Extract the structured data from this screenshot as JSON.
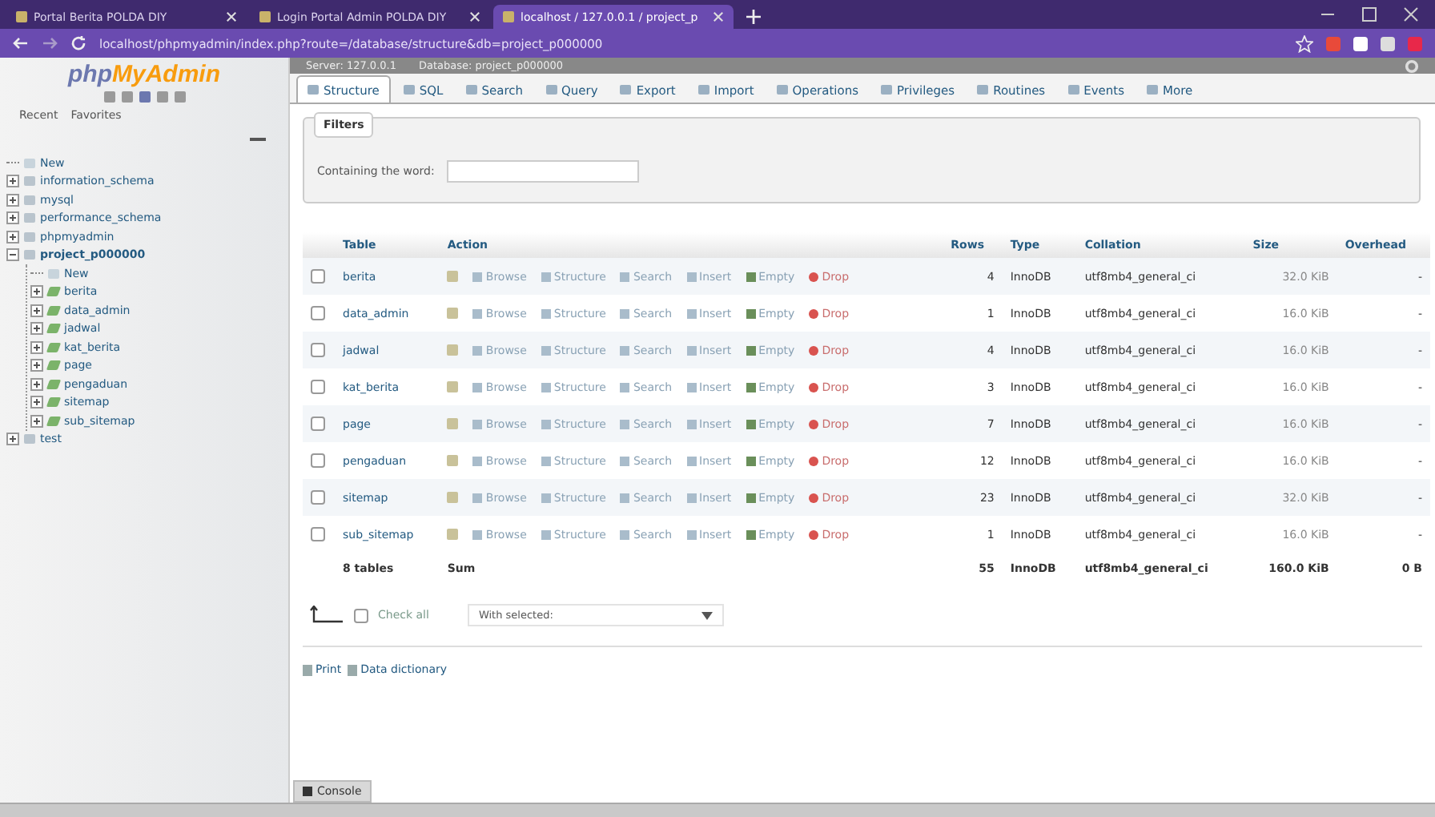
{
  "browser": {
    "tabs": [
      {
        "title": "Portal Berita POLDA DIY",
        "selected": false
      },
      {
        "title": "Login Portal Admin POLDA DIY",
        "selected": false
      },
      {
        "title": "localhost / 127.0.0.1 / project_p",
        "selected": true
      }
    ],
    "address": "localhost/phpmyadmin/index.php?route=/database/structure&db=project_p000000"
  },
  "sidebar": {
    "logo_left": "php",
    "logo_right": "MyAdmin",
    "links": [
      "Recent",
      "Favorites"
    ],
    "tree": [
      {
        "label": "New",
        "kind": "new"
      },
      {
        "label": "information_schema",
        "kind": "db",
        "expanded": false
      },
      {
        "label": "mysql",
        "kind": "db",
        "expanded": false
      },
      {
        "label": "performance_schema",
        "kind": "db",
        "expanded": false
      },
      {
        "label": "phpmyadmin",
        "kind": "db",
        "expanded": false
      },
      {
        "label": "project_p000000",
        "kind": "db",
        "expanded": true,
        "children": [
          {
            "label": "New",
            "kind": "new"
          },
          {
            "label": "berita",
            "kind": "table",
            "expanded": false
          },
          {
            "label": "data_admin",
            "kind": "table",
            "expanded": false
          },
          {
            "label": "jadwal",
            "kind": "table",
            "expanded": false
          },
          {
            "label": "kat_berita",
            "kind": "table",
            "expanded": false
          },
          {
            "label": "page",
            "kind": "table",
            "expanded": false
          },
          {
            "label": "pengaduan",
            "kind": "table",
            "expanded": false
          },
          {
            "label": "sitemap",
            "kind": "table",
            "expanded": false
          },
          {
            "label": "sub_sitemap",
            "kind": "table",
            "expanded": false
          }
        ]
      },
      {
        "label": "test",
        "kind": "db",
        "expanded": false
      }
    ]
  },
  "breadcrumb": [
    "Server: 127.0.0.1",
    "Database: project_p000000"
  ],
  "menu": [
    {
      "label": "Structure",
      "selected": true
    },
    {
      "label": "SQL",
      "selected": false
    },
    {
      "label": "Search",
      "selected": false
    },
    {
      "label": "Query",
      "selected": false
    },
    {
      "label": "Export",
      "selected": false
    },
    {
      "label": "Import",
      "selected": false
    },
    {
      "label": "Operations",
      "selected": false
    },
    {
      "label": "Privileges",
      "selected": false
    },
    {
      "label": "Routines",
      "selected": false
    },
    {
      "label": "Events",
      "selected": false
    },
    {
      "label": "More",
      "selected": false
    }
  ],
  "filters": {
    "legend": "Filters",
    "label": "Containing the word:"
  },
  "table": {
    "columns": [
      "Table",
      "Action",
      "Rows",
      "Type",
      "Collation",
      "Size",
      "Overhead"
    ],
    "rows": [
      {
        "name": "berita",
        "checked": false,
        "actions": [
          "Browse",
          "Structure",
          "Search",
          "Insert",
          "Empty",
          "Drop"
        ],
        "rows": "4",
        "type": "InnoDB",
        "collation": "utf8mb4_general_ci",
        "size": "32.0 KiB",
        "overhead": "-"
      },
      {
        "name": "data_admin",
        "checked": false,
        "actions": [
          "Browse",
          "Structure",
          "Search",
          "Insert",
          "Empty",
          "Drop"
        ],
        "rows": "1",
        "type": "InnoDB",
        "collation": "utf8mb4_general_ci",
        "size": "16.0 KiB",
        "overhead": "-"
      },
      {
        "name": "jadwal",
        "checked": false,
        "actions": [
          "Browse",
          "Structure",
          "Search",
          "Insert",
          "Empty",
          "Drop"
        ],
        "rows": "4",
        "type": "InnoDB",
        "collation": "utf8mb4_general_ci",
        "size": "16.0 KiB",
        "overhead": "-"
      },
      {
        "name": "kat_berita",
        "checked": false,
        "actions": [
          "Browse",
          "Structure",
          "Search",
          "Insert",
          "Empty",
          "Drop"
        ],
        "rows": "3",
        "type": "InnoDB",
        "collation": "utf8mb4_general_ci",
        "size": "16.0 KiB",
        "overhead": "-"
      },
      {
        "name": "page",
        "checked": false,
        "actions": [
          "Browse",
          "Structure",
          "Search",
          "Insert",
          "Empty",
          "Drop"
        ],
        "rows": "7",
        "type": "InnoDB",
        "collation": "utf8mb4_general_ci",
        "size": "16.0 KiB",
        "overhead": "-"
      },
      {
        "name": "pengaduan",
        "checked": false,
        "actions": [
          "Browse",
          "Structure",
          "Search",
          "Insert",
          "Empty",
          "Drop"
        ],
        "rows": "12",
        "type": "InnoDB",
        "collation": "utf8mb4_general_ci",
        "size": "16.0 KiB",
        "overhead": "-"
      },
      {
        "name": "sitemap",
        "checked": false,
        "actions": [
          "Browse",
          "Structure",
          "Search",
          "Insert",
          "Empty",
          "Drop"
        ],
        "rows": "23",
        "type": "InnoDB",
        "collation": "utf8mb4_general_ci",
        "size": "32.0 KiB",
        "overhead": "-"
      },
      {
        "name": "sub_sitemap",
        "checked": false,
        "actions": [
          "Browse",
          "Structure",
          "Search",
          "Insert",
          "Empty",
          "Drop"
        ],
        "rows": "1",
        "type": "InnoDB",
        "collation": "utf8mb4_general_ci",
        "size": "16.0 KiB",
        "overhead": "-"
      }
    ],
    "summary": {
      "count": "8 tables",
      "label": "Sum",
      "rows": "55",
      "type": "InnoDB",
      "collation": "utf8mb4_general_ci",
      "size": "160.0 KiB",
      "overhead": "0 B"
    }
  },
  "bulk": {
    "check_all": "Check all",
    "checked": false,
    "select_placeholder": "With selected:"
  },
  "links": [
    "Print",
    "Data dictionary"
  ],
  "console": "Console"
}
